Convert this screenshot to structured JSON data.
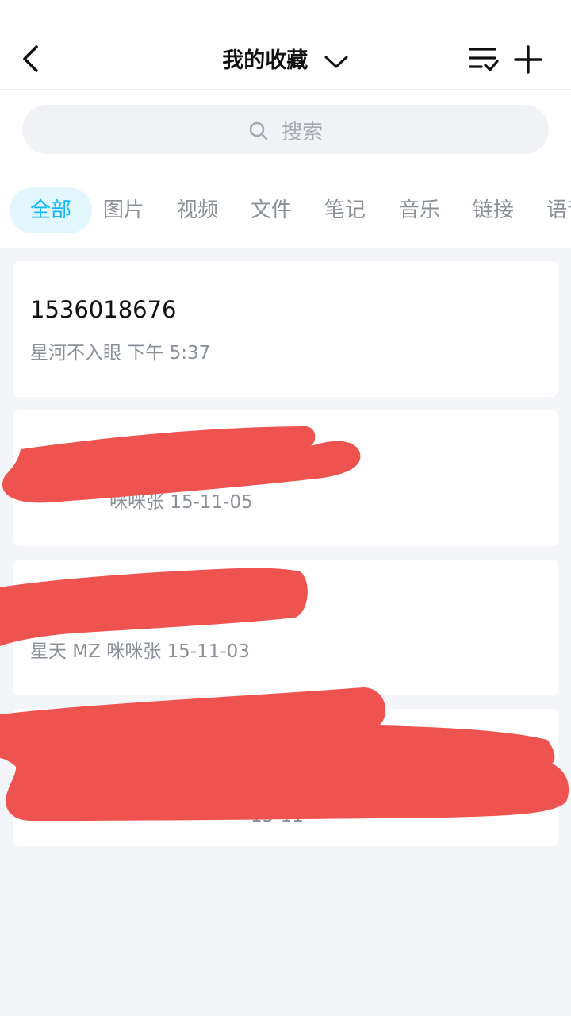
{
  "header": {
    "title": "我的收藏",
    "back_icon": "chevron-left-icon",
    "dropdown_icon": "chevron-down-icon",
    "sort_icon": "list-check-icon",
    "add_icon": "plus-icon"
  },
  "search": {
    "placeholder": "搜索",
    "icon": "search-icon"
  },
  "tabs": [
    {
      "label": "全部",
      "active": true
    },
    {
      "label": "图片"
    },
    {
      "label": "视频"
    },
    {
      "label": "文件"
    },
    {
      "label": "笔记"
    },
    {
      "label": "音乐"
    },
    {
      "label": "链接"
    },
    {
      "label": "语音"
    }
  ],
  "items": [
    {
      "title": "1536018676",
      "meta": "星河不入眼 下午 5:37"
    },
    {
      "title": "",
      "meta": "咪咪张 15-11-05"
    },
    {
      "title": "",
      "meta": "星天 MZ 咪咪张 15-11-03"
    },
    {
      "title": "",
      "meta": "15-11"
    }
  ],
  "colors": {
    "accent": "#12b7f5",
    "tab_active_bg": "#e2f6fd",
    "redaction": "#ef5350",
    "page_bg": "#f4f5f9"
  }
}
